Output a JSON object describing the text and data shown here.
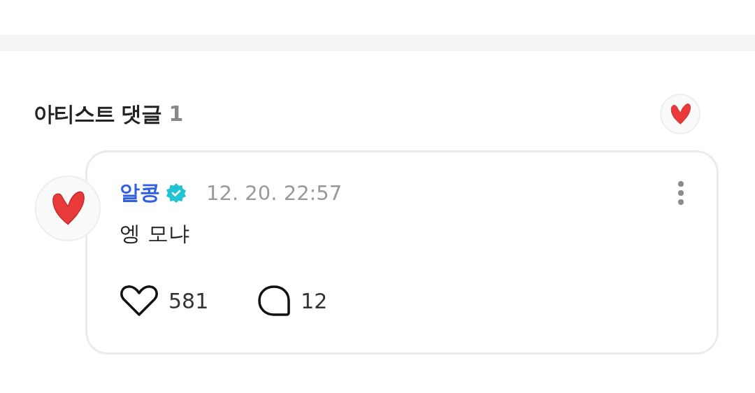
{
  "section": {
    "title": "아티스트 댓글",
    "count": "1"
  },
  "comment": {
    "author": "알콩",
    "verified": true,
    "time": "12. 20. 22:57",
    "text": "엥 모냐",
    "likes": {
      "count": "581",
      "liked": false
    },
    "replies": {
      "count": "12"
    }
  }
}
